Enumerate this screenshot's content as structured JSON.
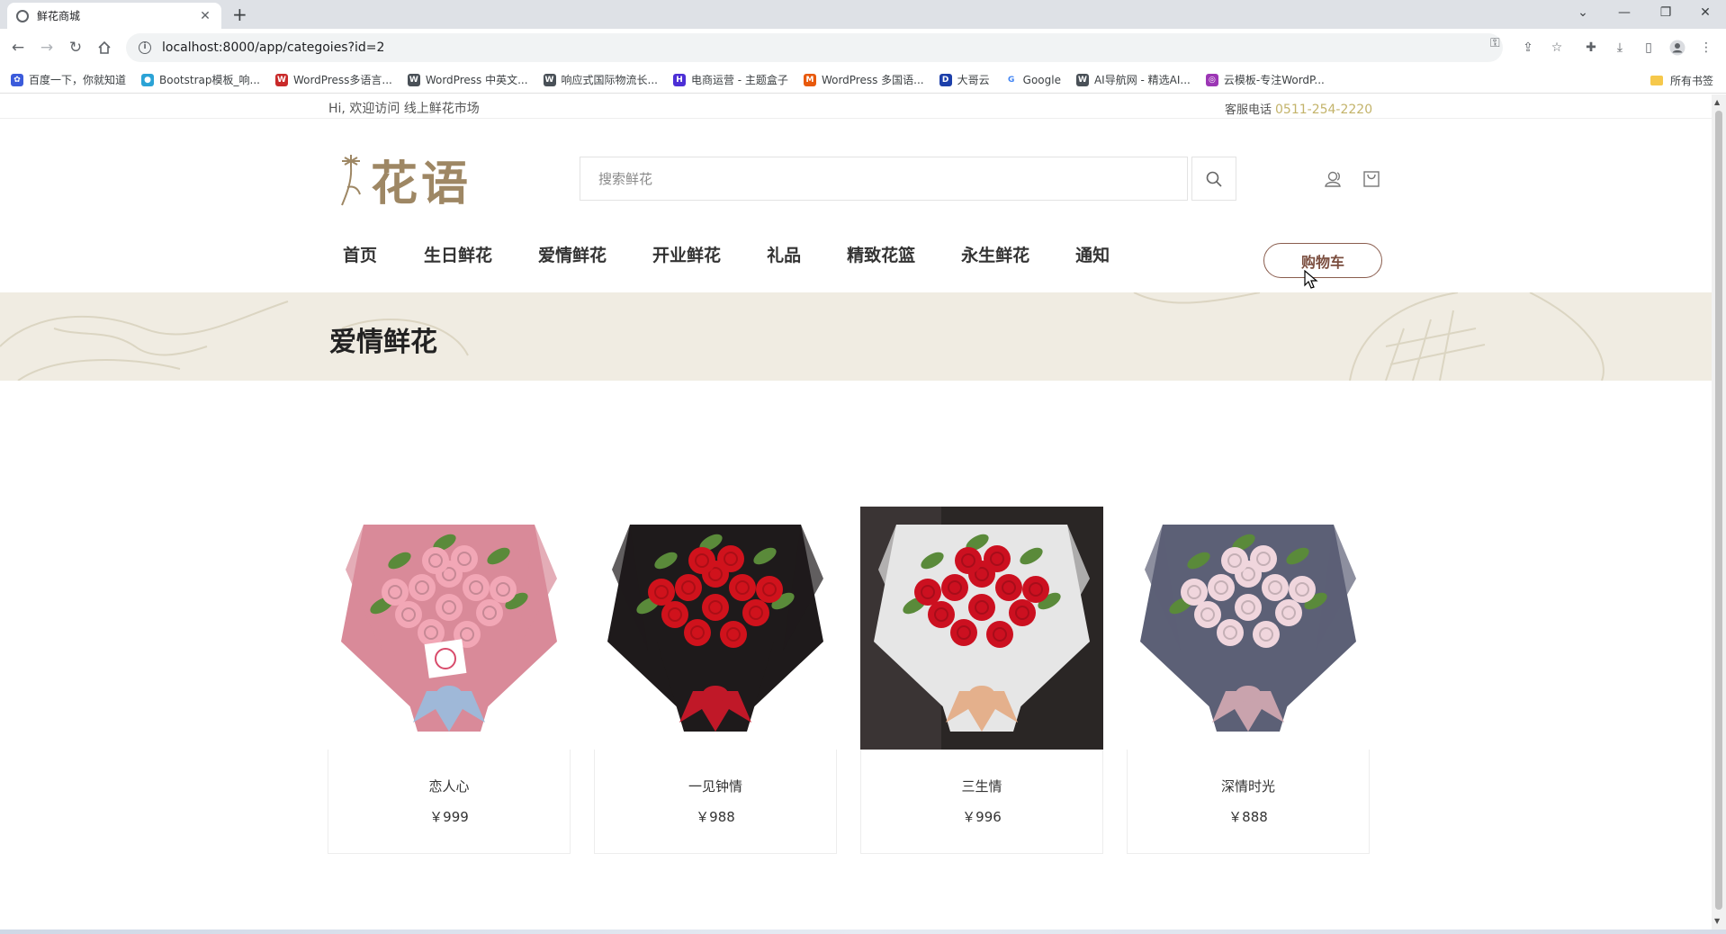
{
  "browser": {
    "tab_title": "鲜花商城",
    "url": "localhost:8000/app/categoies?id=2",
    "bookmarks": [
      {
        "label": "百度一下，你就知道",
        "color": "#3b5bdb",
        "glyph": "✿"
      },
      {
        "label": "Bootstrap模板_响...",
        "color": "#2ba3d6",
        "glyph": "●"
      },
      {
        "label": "WordPress多语言...",
        "color": "#c92a2a",
        "glyph": "W"
      },
      {
        "label": "WordPress 中英文...",
        "color": "#495057",
        "glyph": "W"
      },
      {
        "label": "响应式国际物流长...",
        "color": "#495057",
        "glyph": "W"
      },
      {
        "label": "电商运营 - 主题盒子",
        "color": "#4c2fd6",
        "glyph": "H"
      },
      {
        "label": "WordPress 多国语...",
        "color": "#e8590c",
        "glyph": "M"
      },
      {
        "label": "大哥云",
        "color": "#1c3faa",
        "glyph": "D"
      },
      {
        "label": "Google",
        "color": "#ffffff",
        "glyph": "G"
      },
      {
        "label": "AI导航网 - 精选AI...",
        "color": "#495057",
        "glyph": "W"
      },
      {
        "label": "云模板-专注WordP...",
        "color": "#9c36b5",
        "glyph": "◎"
      }
    ],
    "all_bookmarks": "所有书签"
  },
  "topbar": {
    "welcome": "Hi, 欢迎访问 线上鲜花市场",
    "service_label": "客服电话",
    "phone": "0511-254-2220"
  },
  "header": {
    "logo_text": "花语",
    "search_placeholder": "搜索鲜花"
  },
  "nav": {
    "items": [
      "首页",
      "生日鲜花",
      "爱情鲜花",
      "开业鲜花",
      "礼品",
      "精致花篮",
      "永生鲜花",
      "通知"
    ],
    "cart": "购物车"
  },
  "banner": {
    "title": "爱情鲜花"
  },
  "products": [
    {
      "name": "恋人心",
      "price": "￥999",
      "wrap": "#d98a99",
      "flower": "#f2a7b6",
      "bg": "#ffffff",
      "ribbon": "#9fb8d8"
    },
    {
      "name": "一见钟情",
      "price": "￥988",
      "wrap": "#1e1a1b",
      "flower": "#d0121c",
      "bg": "#ffffff",
      "ribbon": "#c01828"
    },
    {
      "name": "三生情",
      "price": "￥996",
      "wrap": "#e6e6e6",
      "flower": "#cc1020",
      "bg": "#2a2625",
      "ribbon": "#e4b08c"
    },
    {
      "name": "深情时光",
      "price": "￥888",
      "wrap": "#5c6076",
      "flower": "#f0d6dd",
      "bg": "#ffffff",
      "ribbon": "#c9a3ad"
    }
  ],
  "colors": {
    "accent_gold": "#c3b36a",
    "logo_brown": "#9e8764",
    "cart_border": "#8a5d4e",
    "banner_bg": "#f0ece2"
  }
}
